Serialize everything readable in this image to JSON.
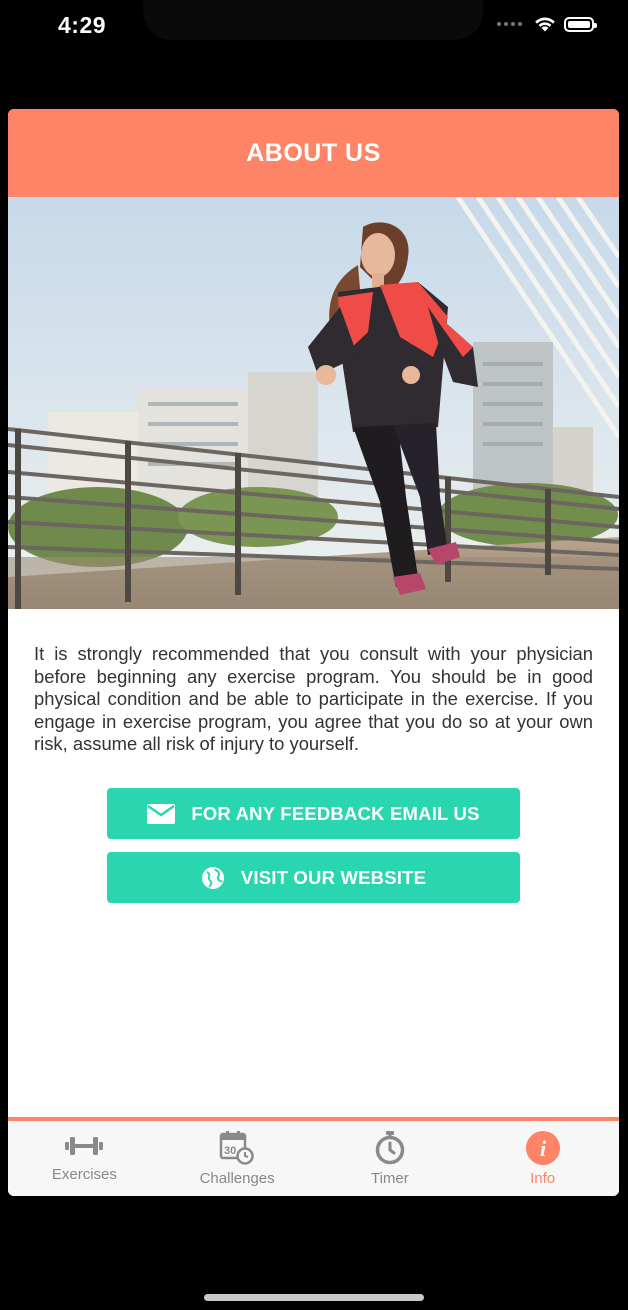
{
  "status_bar": {
    "time": "4:29"
  },
  "header": {
    "title": "ABOUT US"
  },
  "disclaimer": "It is strongly recommended that you consult with your physician before beginning any exercise program. You should be in good physical condition and be able to participate in the exercise. If you engage in exercise program, you agree that you do so at your own risk, assume all risk of injury to yourself.",
  "buttons": {
    "email_label": "FOR ANY FEEDBACK EMAIL US",
    "website_label": "VISIT OUR WEBSITE"
  },
  "tabs": [
    {
      "label": "Exercises",
      "icon": "dumbbell-icon",
      "active": false
    },
    {
      "label": "Challenges",
      "icon": "calendar-clock-icon",
      "active": false
    },
    {
      "label": "Timer",
      "icon": "stopwatch-icon",
      "active": false
    },
    {
      "label": "Info",
      "icon": "info-icon",
      "active": true
    }
  ],
  "colors": {
    "accent": "#fd8466",
    "button": "#2ad6b0",
    "tab_inactive": "#888888"
  }
}
